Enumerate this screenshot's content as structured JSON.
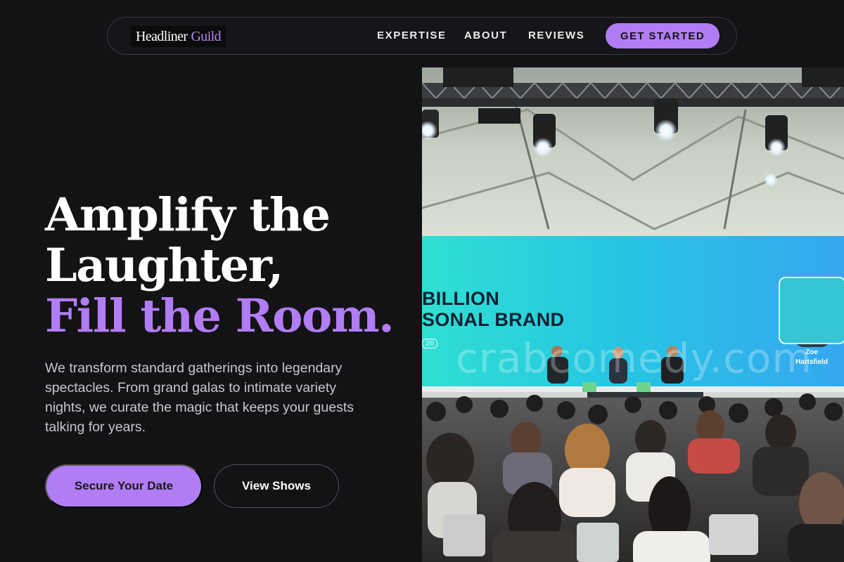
{
  "brand": {
    "name_part1": "Headliner",
    "name_part2": "Guild"
  },
  "nav": {
    "links": [
      "EXPERTISE",
      "ABOUT",
      "REVIEWS"
    ],
    "cta": "GET STARTED"
  },
  "hero": {
    "headline_line1": "Amplify the",
    "headline_line2": "Laughter,",
    "headline_accent": "Fill the Room.",
    "description": "We transform standard gatherings into legendary spectacles. From grand galas to intimate variety nights, we curate the magic that keeps your guests talking for years.",
    "primary_button": "Secure Your Date",
    "secondary_button": "View Shows"
  },
  "photo": {
    "screen_line1": "BILLION",
    "screen_line2": "SONAL BRAND",
    "screen_small": "26",
    "speaker_first": "Zoe",
    "speaker_last": "Hartsfield",
    "watermark": "crabcomedy.com"
  },
  "colors": {
    "background": "#131214",
    "accent": "#b17df4",
    "text": "#ffffff",
    "muted_text": "#c9c7cc"
  }
}
